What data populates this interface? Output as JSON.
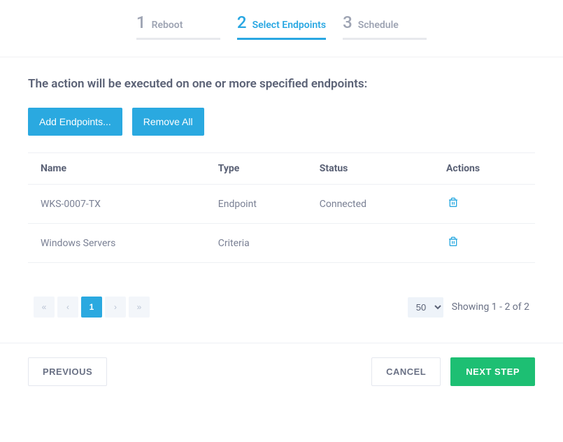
{
  "steps": [
    {
      "num": "1",
      "label": "Reboot",
      "active": false
    },
    {
      "num": "2",
      "label": "Select Endpoints",
      "active": true
    },
    {
      "num": "3",
      "label": "Schedule",
      "active": false
    }
  ],
  "instruction": "The action will be executed on one or more specified endpoints:",
  "buttons": {
    "add_endpoints": "Add Endpoints...",
    "remove_all": "Remove All"
  },
  "table": {
    "headers": {
      "name": "Name",
      "type": "Type",
      "status": "Status",
      "actions": "Actions"
    },
    "rows": [
      {
        "name": "WKS-0007-TX",
        "type": "Endpoint",
        "status": "Connected"
      },
      {
        "name": "Windows Servers",
        "type": "Criteria",
        "status": ""
      }
    ]
  },
  "pagination": {
    "current": "1",
    "page_size": "50",
    "showing": "Showing 1 - 2 of 2"
  },
  "footer": {
    "previous": "PREVIOUS",
    "cancel": "CANCEL",
    "next": "NEXT STEP"
  }
}
